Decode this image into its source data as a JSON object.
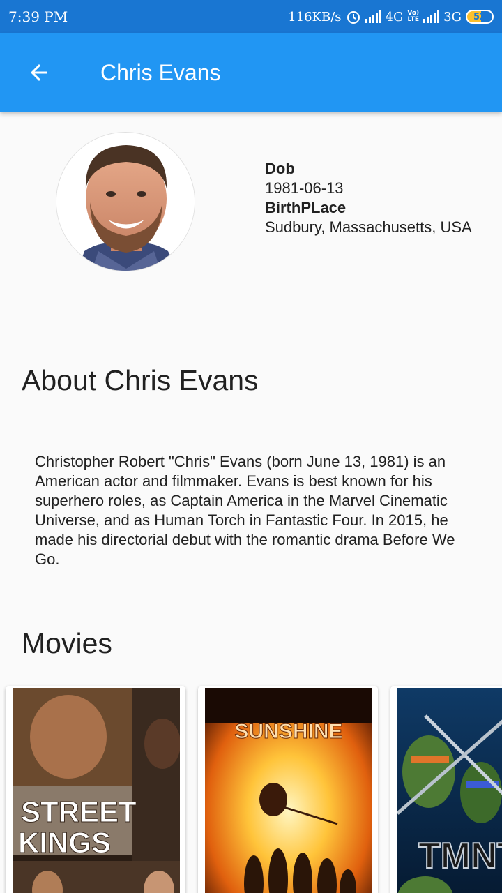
{
  "status_bar": {
    "time": "7:39 PM",
    "speed": "116KB/s",
    "net1": "4G",
    "volte_top": "Vo)",
    "volte_bottom": "LTE",
    "net2": "3G",
    "battery": "52",
    "icons": [
      "alarm-icon",
      "signal-icon",
      "battery-icon"
    ]
  },
  "app_bar": {
    "title": "Chris Evans",
    "back_icon": "arrow-back-icon",
    "color": "#2196f3"
  },
  "profile": {
    "dob_label": "Dob",
    "dob": "1981-06-13",
    "birthplace_label": "BirthPLace",
    "birthplace": "Sudbury, Massachusetts, USA"
  },
  "about": {
    "heading": "About Chris Evans",
    "text": "Christopher Robert \"Chris\" Evans (born June 13, 1981) is an American actor and filmmaker. Evans is best known for his superhero roles, as Captain America in the Marvel Cinematic Universe, and as Human Torch in Fantastic Four. In 2015, he made his directorial debut with the romantic drama Before We Go."
  },
  "movies": {
    "heading": "Movies",
    "items": [
      {
        "line1": "STREET",
        "line2": "KINGS"
      },
      {
        "title": "SUNSHINE"
      },
      {
        "title": "TMNT"
      }
    ]
  }
}
